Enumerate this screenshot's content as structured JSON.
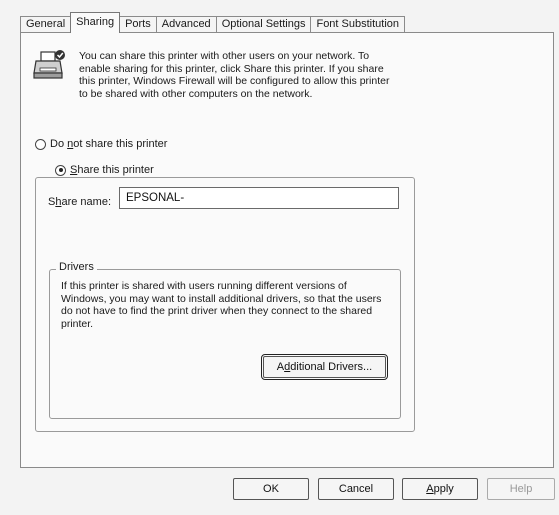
{
  "tabs": [
    {
      "label": "General"
    },
    {
      "label": "Sharing"
    },
    {
      "label": "Ports"
    },
    {
      "label": "Advanced"
    },
    {
      "label": "Optional Settings"
    },
    {
      "label": "Font Substitution"
    }
  ],
  "intro_text": "You can share this printer with other users on your network. To enable sharing for this printer, click Share this printer. If you share this printer, Windows Firewall will be configured to allow this printer to be shared with other computers on the network.",
  "do_not_share": {
    "pre": "Do ",
    "u": "n",
    "post": "ot share this printer"
  },
  "share": {
    "pre": "",
    "u": "S",
    "post": "hare this printer"
  },
  "share_name_label": {
    "pre": "S",
    "u": "h",
    "post": "are name:"
  },
  "share_name_value": "EPSONAL-",
  "drivers": {
    "legend": "Drivers",
    "text": "If this printer is shared with users running different versions of Windows, you may want to install additional drivers, so that the users do not have to find the print driver when they connect to the shared printer.",
    "button": {
      "pre": "A",
      "u": "d",
      "post": "ditional Drivers..."
    }
  },
  "buttons": {
    "ok": "OK",
    "cancel": "Cancel",
    "apply": {
      "pre": "",
      "u": "A",
      "post": "pply"
    },
    "help": "Help"
  }
}
